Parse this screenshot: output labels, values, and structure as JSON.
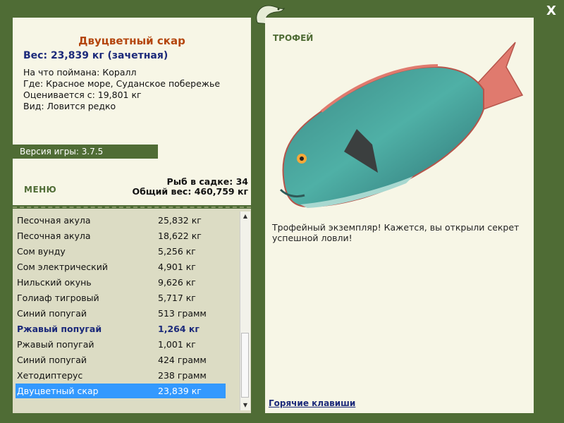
{
  "window": {
    "close_label": "X"
  },
  "fish": {
    "title": "Двуцветный скар",
    "weight": "Вес: 23,839 кг (зачетная)",
    "caught_on": "На что поймана: Коралл",
    "place": "Где: Красное море, Суданское побережье",
    "valued_from": "Оценивается с: 19,801 кг",
    "kind": "Вид: Ловится редко"
  },
  "version": "Версия игры: 3.7.5",
  "menu_label": "МЕНЮ",
  "stats": {
    "fish_in_keepnet": "Рыб в садке: 34",
    "total_weight": "Общий вес: 460,759 кг"
  },
  "catch_list": [
    {
      "name": "Песочная акула",
      "weight": "25,832 кг"
    },
    {
      "name": "Песочная акула",
      "weight": "18,622 кг"
    },
    {
      "name": "Сом вунду",
      "weight": "5,256 кг"
    },
    {
      "name": "Сом электрический",
      "weight": "4,901 кг"
    },
    {
      "name": "Нильский окунь",
      "weight": "9,626 кг"
    },
    {
      "name": "Голиаф тигровый",
      "weight": "5,717 кг"
    },
    {
      "name": "Синий попугай",
      "weight": "513 грамм"
    },
    {
      "name": "Ржавый попугай",
      "weight": "1,264 кг"
    },
    {
      "name": "Ржавый попугай",
      "weight": "1,001 кг"
    },
    {
      "name": "Синий попугай",
      "weight": "424 грамм"
    },
    {
      "name": "Хетодиптерус",
      "weight": "238 грамм"
    },
    {
      "name": "Двуцветный скар",
      "weight": "23,839 кг"
    }
  ],
  "right": {
    "badge": "ТРОФЕЙ",
    "description": "Трофейный экземпляр! Кажется, вы открыли секрет успешной ловли!",
    "hotkeys": "Горячие клавиши"
  },
  "colors": {
    "frame": "#4f6c35",
    "panel": "#f7f6e6",
    "title": "#b4460e",
    "accent_blue": "#1c2a7a",
    "selection": "#3399ff"
  }
}
